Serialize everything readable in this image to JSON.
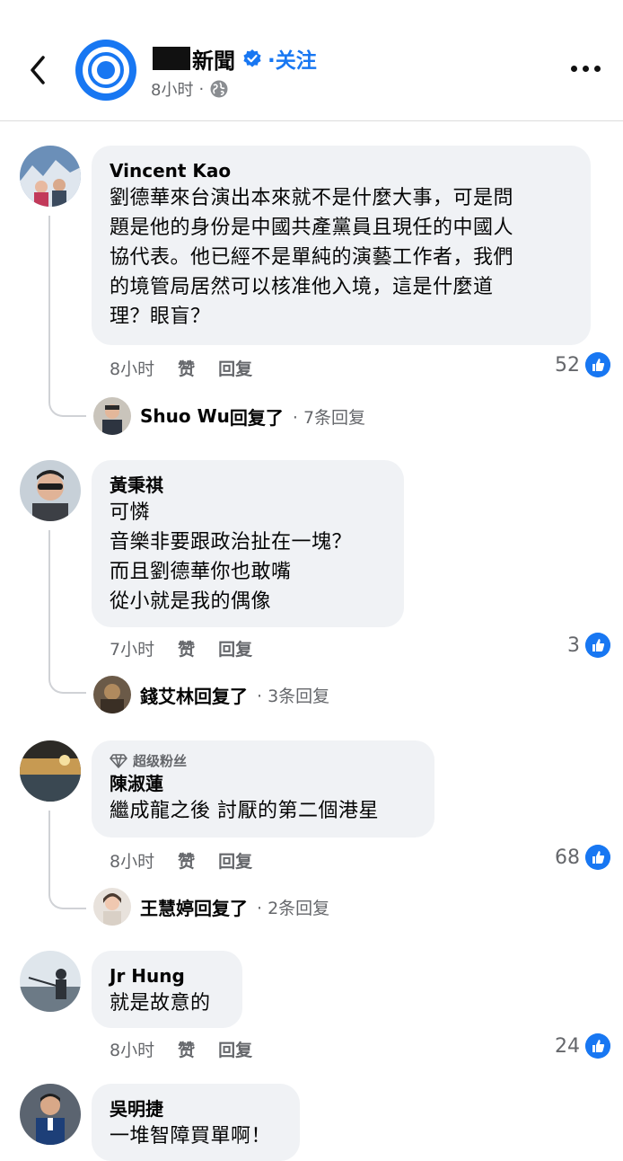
{
  "header": {
    "page_name": "新聞",
    "follow_label": "·关注",
    "time": "8小时",
    "dot": "·"
  },
  "comments": [
    {
      "author": "Vincent  Kao",
      "lines": [
        "劉德華來台演出本來就不是什麼大事，可是問",
        "題是他的身份是中國共產黨員且現任的中國人",
        "協代表。他已經不是單純的演藝工作者，我們",
        "的境管局居然可以核准他入境，這是什麼道",
        "理？眼盲？"
      ],
      "time": "8小时",
      "like_label": "赞",
      "reply_label": "回复",
      "likes": "52",
      "reply": {
        "name": "Shuo Wu",
        "suffix": "回复了",
        "count": "· 7条回复"
      }
    },
    {
      "author": "黃秉祺",
      "lines": [
        "可憐",
        "音樂非要跟政治扯在一塊？",
        "而且劉德華你也敢嘴",
        "從小就是我的偶像"
      ],
      "time": "7小时",
      "like_label": "赞",
      "reply_label": "回复",
      "likes": "3",
      "reply": {
        "name": "錢艾林",
        "suffix": "回复了",
        "count": "· 3条回复"
      }
    },
    {
      "badge": "超级粉丝",
      "author": "陳淑蓮",
      "lines": [
        "繼成龍之後 討厭的第二個港星"
      ],
      "time": "8小时",
      "like_label": "赞",
      "reply_label": "回复",
      "likes": "68",
      "reply": {
        "name": "王慧婷",
        "suffix": "回复了",
        "count": "· 2条回复"
      }
    },
    {
      "author": "Jr Hung",
      "lines": [
        "就是故意的"
      ],
      "time": "8小时",
      "like_label": "赞",
      "reply_label": "回复",
      "likes": "24"
    },
    {
      "author": "吳明捷",
      "lines": [
        "一堆智障買單啊！"
      ]
    }
  ],
  "colors": {
    "accent": "#1877f2",
    "bubble": "#f0f2f5",
    "muted": "#65676b"
  }
}
